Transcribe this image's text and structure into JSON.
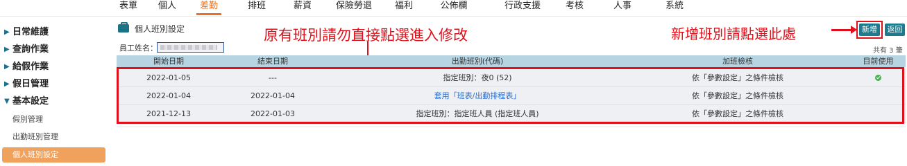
{
  "topnav": {
    "items": [
      "表單",
      "個人",
      "差勤",
      "排班",
      "薪資",
      "保險勞退",
      "福利",
      "公佈欄",
      "行政支援",
      "考核",
      "人事",
      "系統"
    ],
    "active": "差勤",
    "accent_color": "#e8731f"
  },
  "sidebar": {
    "sections": [
      "日常維護",
      "查詢作業",
      "給假作業",
      "假日管理",
      "基本設定"
    ],
    "subitems": [
      "假別管理",
      "出勤班別管理",
      "個人班別設定"
    ],
    "active_subitem": "個人班別設定"
  },
  "page": {
    "title": "個人班別設定",
    "icon": "briefcase-icon",
    "employee_label": "員工姓名：",
    "record_count": "共有 3 筆"
  },
  "annotations": {
    "left": "原有班別請勿直接點選進入修改",
    "right": "新增班別請點選此處",
    "color": "#e0101a"
  },
  "buttons": {
    "add": "新增",
    "back": "返回"
  },
  "table": {
    "headers": [
      "開始日期",
      "結束日期",
      "出勤班別(代碼)",
      "加班檢核",
      "目前使用"
    ],
    "rows": [
      {
        "start": "2022-01-05",
        "end": "---",
        "shift": "指定班別：夜0 (52)",
        "overtime": "依「參數設定」之條件檢核",
        "current": true
      },
      {
        "start": "2022-01-04",
        "end": "2022-01-04",
        "shift": "套用「班表/出勤排程表」",
        "overtime": "依「參數設定」之條件檢核",
        "current": false
      },
      {
        "start": "2021-12-13",
        "end": "2022-01-03",
        "shift": "指定班別：指定班人員 (指定班人員)",
        "overtime": "依「參數設定」之條件檢核",
        "current": false
      }
    ]
  }
}
